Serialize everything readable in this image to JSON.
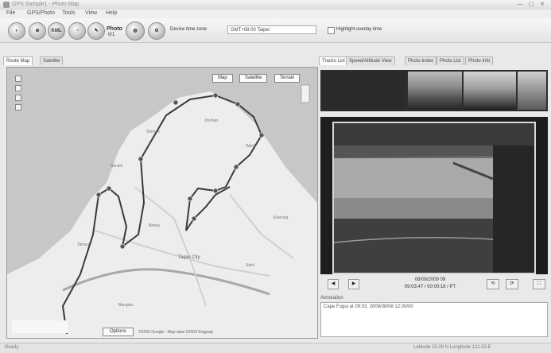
{
  "window": {
    "title": "GPS Sample1 - Photo Map",
    "buttons": [
      "—",
      "▢",
      "✕"
    ]
  },
  "menu": [
    "File",
    "GPS/Photo",
    "Tools",
    "View",
    "Help"
  ],
  "toolbar": {
    "buttons": [
      {
        "name": "import-button",
        "glyph": "◐"
      },
      {
        "name": "gps-button",
        "glyph": "⊕"
      },
      {
        "name": "kml-button",
        "glyph": "KML"
      },
      {
        "name": "clock-button",
        "glyph": "◔"
      },
      {
        "name": "route-button",
        "glyph": "✎"
      },
      {
        "name": "photo-button",
        "glyph": "▣"
      },
      {
        "name": "globe-button",
        "glyph": "◍"
      },
      {
        "name": "settings-button",
        "glyph": "⚙"
      }
    ],
    "photo_label": "Photo",
    "photo_count": "0/1",
    "tz_label": "Device time zone",
    "tz_value": "GMT+08:00 Taipei",
    "highlight_label": "Highlight overlay time"
  },
  "left_tabs": [
    "Route Map",
    "Satellite"
  ],
  "map": {
    "type_buttons": [
      "Map",
      "Satellite",
      "Terrain"
    ],
    "footer_button": "Options",
    "copyright": "©2009 Google - Map data ©2009 Kingway",
    "places": [
      "Taipei City",
      "Tamsui",
      "Beitou",
      "Wanli",
      "Jinshan",
      "Shimen",
      "Keelung",
      "Sanzhi",
      "Xizhi",
      "Banqiao"
    ]
  },
  "right_tabs": [
    "Tracks List",
    "Speed/Altitude View",
    "Photo Index",
    "Photo List",
    "Photo Info"
  ],
  "video": {
    "controls": [
      "◀",
      "▶"
    ],
    "time_line1": "08/08/2009 09",
    "time_line2": "09:03:47 / 00:00:18 / PT",
    "side_buttons": [
      "⟲",
      "⟳",
      "⛶"
    ]
  },
  "annotation": {
    "label": "Annotation",
    "text": "Cape Fugui at 09:03, 2009/08/08 12:00/00"
  },
  "status": {
    "left": "Ready",
    "right": "Latitude 25.28 N Longitude 121.53 E"
  }
}
